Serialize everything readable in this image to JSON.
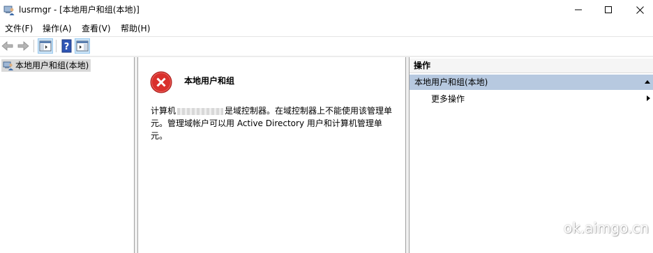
{
  "window": {
    "title": "lusrmgr - [本地用户和组(本地)]",
    "app_icon": "users-computer-icon"
  },
  "menu": {
    "items": [
      "文件(F)",
      "操作(A)",
      "查看(V)",
      "帮助(H)"
    ]
  },
  "toolbar": {
    "buttons": [
      "back-arrow-icon",
      "forward-arrow-icon",
      "show-hide-console-tree-icon",
      "help-icon",
      "show-hide-action-pane-icon"
    ]
  },
  "tree": {
    "root_label": "本地用户和组(本地)"
  },
  "message": {
    "title": "本地用户和组",
    "body_prefix": "计算机",
    "body_suffix": "是域控制器。在域控制器上不能使用该管理单元。管理域帐户可以用 Active Directory 用户和计算机管理单元。",
    "icon": "error-icon"
  },
  "actions": {
    "header": "操作",
    "group_label": "本地用户和组(本地)",
    "more_actions": "更多操作"
  },
  "watermark": {
    "text": "ok.aimgo.cn"
  },
  "colors": {
    "actions_group_bg": "#b7c9e0",
    "tree_selected_bg": "#d9d9d9",
    "error_red": "#d9302c"
  }
}
